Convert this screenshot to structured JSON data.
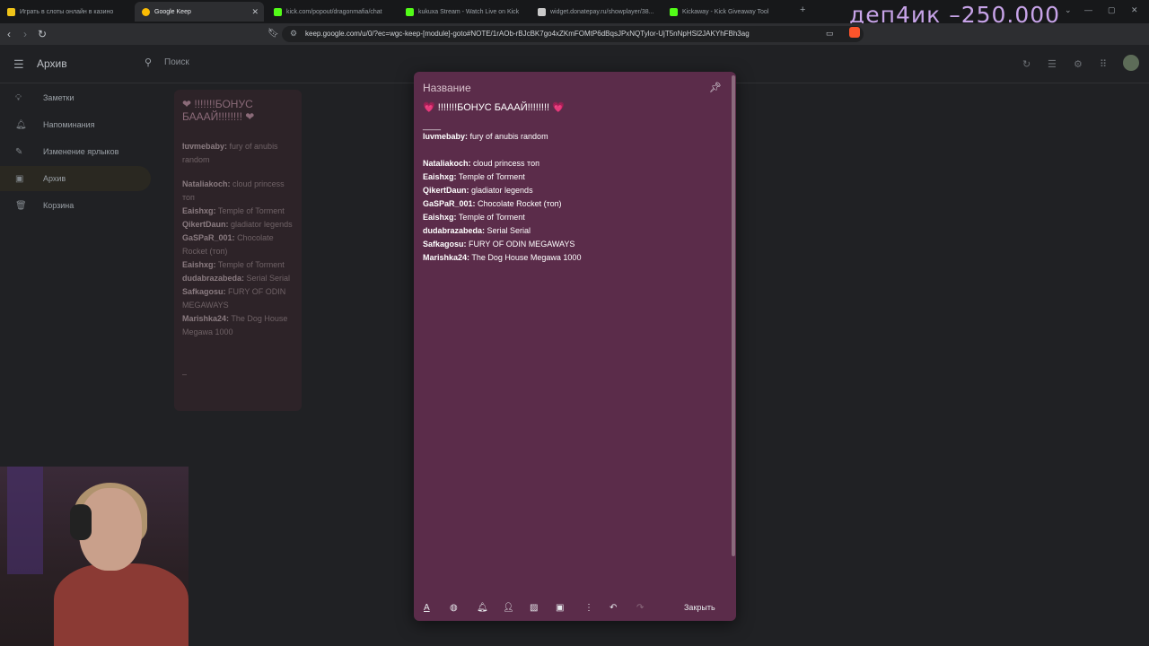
{
  "browser": {
    "tabs": [
      {
        "label": "Играть в слоты онлайн в казино",
        "icon_color": "#f0c419"
      },
      {
        "label": "Google Keep",
        "icon_color": "#fbbc04"
      },
      {
        "label": "kick.com/popout/dragonmafia/chat",
        "icon_color": "#53fc18"
      },
      {
        "label": "kukuxa Stream - Watch Live on Kick",
        "icon_color": "#53fc18"
      },
      {
        "label": "widget.donatepay.ru/showplayer/38...",
        "icon_color": "#c9c9c9"
      },
      {
        "label": "Kickaway - Kick Giveaway Tool",
        "icon_color": "#53fc18"
      }
    ],
    "url": "keep.google.com/u/0/?ec=wgc-keep-[module]-goto#NOTE/1rAOb-rBJcBK7go4xZKmFOMtP6dBqsJPxNQTylor-UjT5nNpHSl2JAKYhFBh3ag"
  },
  "stream_overlay": "деп4ик –250.000",
  "keep": {
    "header_title": "Архив",
    "search_placeholder": "Поиск",
    "sidebar": [
      {
        "label": "Заметки",
        "icon": "bulb-icon"
      },
      {
        "label": "Напоминания",
        "icon": "bell-icon"
      },
      {
        "label": "Изменение ярлыков",
        "icon": "pencil-icon"
      },
      {
        "label": "Архив",
        "icon": "archive-icon"
      },
      {
        "label": "Корзина",
        "icon": "trash-icon"
      }
    ],
    "bg_card": {
      "title": "❤ !!!!!!!БОНУС БАААЙ!!!!!!!! ❤",
      "lines": [
        {
          "user": "luvmebaby:",
          "game": "fury of anubis random"
        },
        {
          "user": "Nataliakoch:",
          "game": "cloud princess топ"
        },
        {
          "user": "Eaishxg:",
          "game": "Temple of Torment"
        },
        {
          "user": "QikertDaun:",
          "game": "gladiator legends"
        },
        {
          "user": "GaSPaR_001:",
          "game": "Chocolate Rocket (топ)"
        },
        {
          "user": "Eaishxg:",
          "game": "Temple of Torment"
        },
        {
          "user": "dudabrazabeda:",
          "game": "Serial Serial"
        },
        {
          "user": "Safkagosu:",
          "game": "FURY OF ODIN MEGAWAYS"
        },
        {
          "user": "Marishka24:",
          "game": "The Dog House Megawa 1000"
        }
      ]
    },
    "note": {
      "title_placeholder": "Название",
      "headline_heart": "💗",
      "headline": " !!!!!!!БОНУС БАААЙ!!!!!!!! ",
      "separator": "____",
      "first": {
        "user": "luvmebaby:",
        "game": " fury of anubis random"
      },
      "entries": [
        {
          "user": "Nataliakoch:",
          "game": " cloud princess топ"
        },
        {
          "user": "Eaishxg:",
          "game": " Temple of Torment"
        },
        {
          "user": "QikertDaun:",
          "game": " gladiator legends"
        },
        {
          "user": "GaSPaR_001:",
          "game": " Chocolate Rocket (топ)"
        },
        {
          "user": "Eaishxg:",
          "game": " Temple of Torment"
        },
        {
          "user": "dudabrazabeda:",
          "game": " Serial Serial"
        },
        {
          "user": "Safkagosu:",
          "game": " FURY OF ODIN MEGAWAYS"
        },
        {
          "user": "Marishka24:",
          "game": " The Dog House Megawa 1000"
        }
      ],
      "close_label": "Закрыть"
    }
  }
}
